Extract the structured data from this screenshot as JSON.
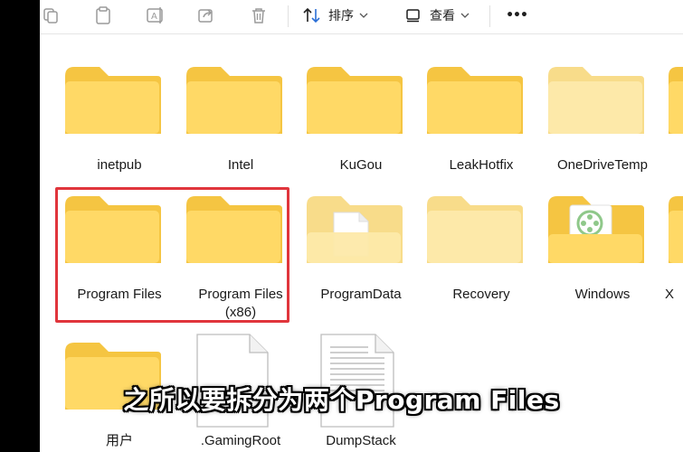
{
  "toolbar": {
    "sort_label": "排序",
    "view_label": "查看",
    "more_label": "•••",
    "icons": [
      "copy-icon",
      "paste-icon",
      "rename-icon",
      "share-icon",
      "delete-icon",
      "sort-icon",
      "view-icon",
      "more-icon"
    ]
  },
  "items": [
    {
      "name": "inetpub",
      "type": "folder"
    },
    {
      "name": "Intel",
      "type": "folder"
    },
    {
      "name": "KuGou",
      "type": "folder"
    },
    {
      "name": "LeakHotfix",
      "type": "folder"
    },
    {
      "name": "OneDriveTemp",
      "type": "folder-faded"
    },
    {
      "name": "Program Files",
      "type": "folder"
    },
    {
      "name": "Program Files",
      "name2": "(x86)",
      "type": "folder"
    },
    {
      "name": "ProgramData",
      "type": "folder-doc-faded"
    },
    {
      "name": "Recovery",
      "type": "folder-faded"
    },
    {
      "name": "Windows",
      "type": "folder-media"
    },
    {
      "name": "X",
      "type": "folder-partial"
    },
    {
      "name": "用户",
      "type": "folder"
    },
    {
      "name": ".GamingRoot",
      "type": "file-blank"
    },
    {
      "name": "DumpStack",
      "type": "file-text"
    }
  ],
  "caption": "之所以要拆分为两个Program Files",
  "colors": {
    "folder_back": "#f5c542",
    "folder_front": "#ffd966",
    "highlight_box": "#e0353c"
  }
}
